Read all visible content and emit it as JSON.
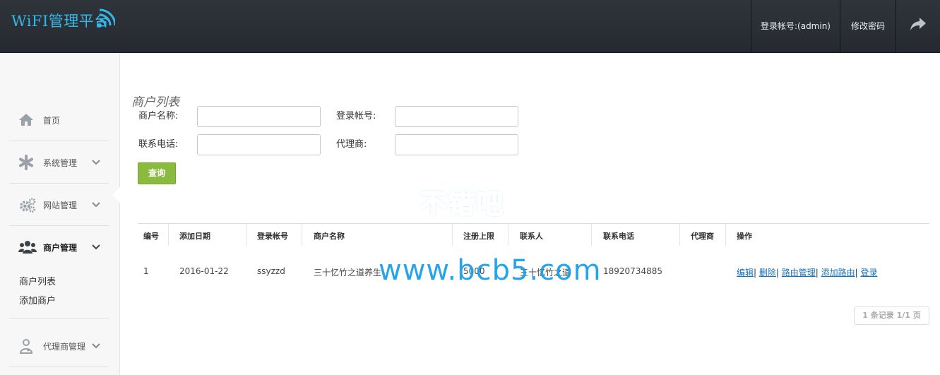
{
  "header": {
    "logo": "WiFI管理平台",
    "user_account": "登录帐号:(admin)",
    "change_password": "修改密码",
    "logout_icon": "share-arrow-icon"
  },
  "sidebar": {
    "items": [
      {
        "label": "首页",
        "icon": "home-icon"
      },
      {
        "label": "系统管理",
        "icon": "asterisk-icon"
      },
      {
        "label": "网站管理",
        "icon": "gears-icon"
      },
      {
        "label": "商户管理",
        "icon": "users-icon"
      },
      {
        "label": "代理商管理",
        "icon": "user-md-icon"
      }
    ],
    "sub_items": [
      "商户列表",
      "添加商户"
    ]
  },
  "main": {
    "title": "商户列表",
    "filters": {
      "merchant_name_label": "商户名称:",
      "login_account_label": "登录帐号:",
      "phone_label": "联系电话:",
      "agent_label": "代理商:",
      "merchant_name_value": "",
      "login_account_value": "",
      "phone_value": "",
      "agent_value": ""
    },
    "query_button": "查询",
    "table": {
      "columns": [
        "编号",
        "添加日期",
        "登录帐号",
        "商户名称",
        "注册上限",
        "联系人",
        "联系电话",
        "代理商",
        "操作"
      ],
      "rows": [
        {
          "id": "1",
          "date": "2016-01-22",
          "account": "ssyzzd",
          "name": "三十忆竹之道养生",
          "limit": "5000",
          "contact": "三十忆竹之道",
          "phone": "18920734885",
          "agent": "",
          "actions": [
            "编辑",
            "删除",
            "路由管理",
            "添加路由",
            "登录"
          ]
        }
      ]
    },
    "pagination": "1 条记录 1/1 页"
  },
  "watermark": {
    "text1": "不错吧",
    "text2": "www.bcb5.com"
  },
  "colors": {
    "header_bg": "#2b3036",
    "logo": "#35b7e8",
    "query_button": "#8bbb3e",
    "link": "#1a73b8",
    "watermark": "#1aa0ea"
  }
}
